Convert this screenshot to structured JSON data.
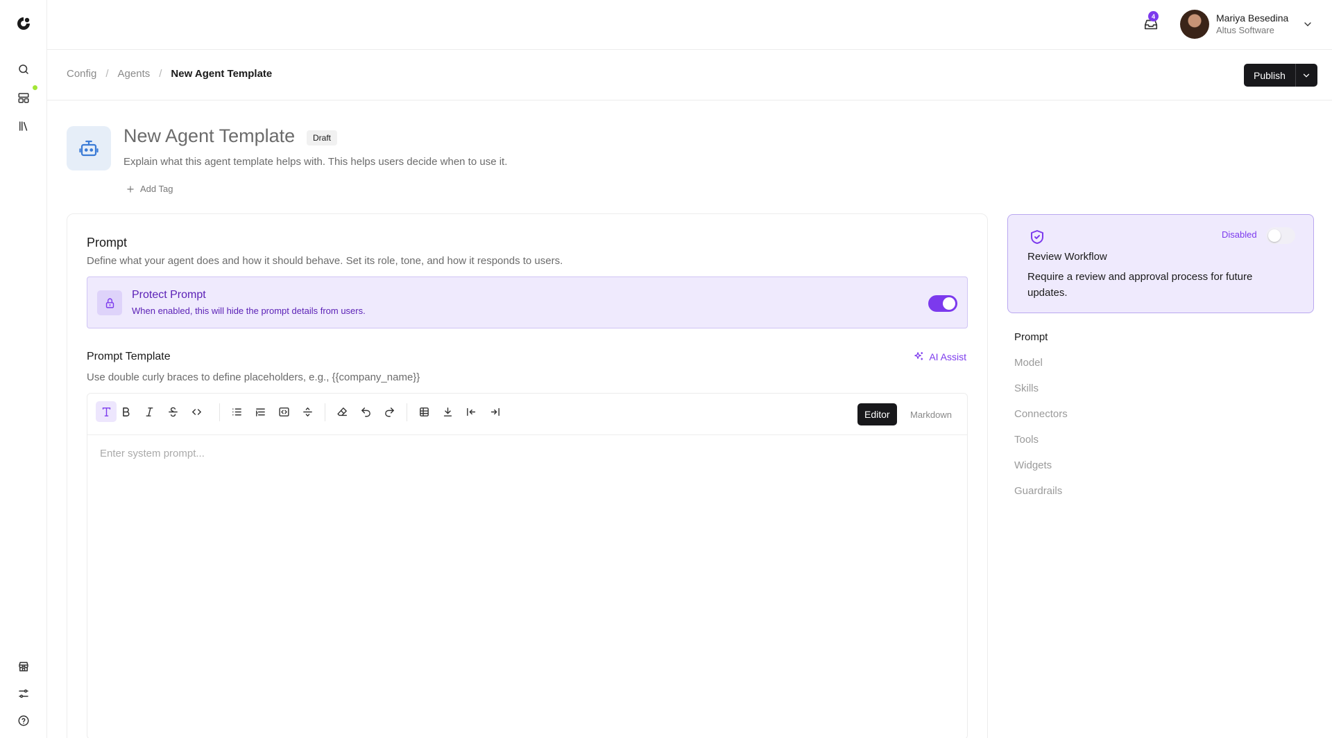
{
  "colors": {
    "accent": "#7c3aed",
    "accent_dark": "#5b21b6",
    "accent_soft": "#efeafd",
    "status_dot": "#a3e635",
    "dark_button": "#18181b"
  },
  "rail": {
    "icons": [
      "logo-icon",
      "search-icon",
      "layout-dashboard-icon",
      "library-icon",
      "store-icon",
      "sliders-icon",
      "help-circle-icon"
    ]
  },
  "header": {
    "inbox_count": "4",
    "user": {
      "name": "Mariya Besedina",
      "org": "Altus Software"
    }
  },
  "breadcrumb": {
    "items": [
      "Config",
      "Agents"
    ],
    "current": "New Agent Template"
  },
  "publish": {
    "label": "Publish"
  },
  "template": {
    "title": "New Agent Template",
    "status": "Draft",
    "description": "Explain what this agent template helps with. This helps users decide when to use it.",
    "add_tag": "Add Tag"
  },
  "prompt_section": {
    "title": "Prompt",
    "description": "Define what your agent does and how it should behave. Set its role, tone, and how it responds to users.",
    "protect": {
      "title": "Protect Prompt",
      "description": "When enabled, this will hide the prompt details from users.",
      "enabled": true
    },
    "template_label": "Prompt Template",
    "ai_assist": "AI Assist",
    "hint": "Use double curly braces to define placeholders, e.g., {{company_name}}",
    "editor": {
      "placeholder": "Enter system prompt...",
      "value": "",
      "modes": [
        "Editor",
        "Markdown"
      ],
      "active_mode": "Editor",
      "toolbar": [
        "text-type-icon",
        "bold-icon",
        "italic-icon",
        "strikethrough-icon",
        "code-icon",
        "bullet-list-icon",
        "ordered-list-icon",
        "code-block-icon",
        "horizontal-rule-icon",
        "eraser-icon",
        "undo-icon",
        "redo-icon",
        "table-icon",
        "download-icon",
        "outdent-icon",
        "indent-icon"
      ]
    }
  },
  "review_workflow": {
    "status": "Disabled",
    "enabled": false,
    "title": "Review Workflow",
    "description": "Require a review and approval process for future updates."
  },
  "section_nav": {
    "active": "Prompt",
    "items": [
      "Prompt",
      "Model",
      "Skills",
      "Connectors",
      "Tools",
      "Widgets",
      "Guardrails"
    ]
  }
}
